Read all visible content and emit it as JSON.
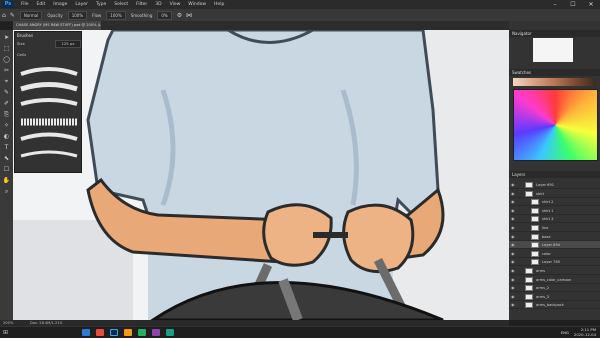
{
  "app": {
    "logo": "Ps"
  },
  "menu": [
    "File",
    "Edit",
    "Image",
    "Layer",
    "Type",
    "Select",
    "Filter",
    "3D",
    "View",
    "Window",
    "Help"
  ],
  "window_controls": {
    "minimize": "–",
    "maximize": "☐",
    "close": "✕"
  },
  "options_bar": {
    "preset": "Normal",
    "opacity_label": "Opacity",
    "opacity": "100%",
    "flow_label": "Flow",
    "flow": "100%",
    "smoothing_label": "Smoothing",
    "smoothing": "0%"
  },
  "document_tab": "CHASE ANGRY (MS RAW STUFF) psd @ 200% (Layer 793, RGB/8) *",
  "brush_panel": {
    "title": "Brushes",
    "size_label": "Size",
    "size": "125 px",
    "folder": "Cells"
  },
  "navigator": {
    "title": "Navigator"
  },
  "swatches": {
    "title": "Swatches"
  },
  "layers": {
    "title": "Layers",
    "items": [
      {
        "name": "Layer 691",
        "indent": 0
      },
      {
        "name": "shirt",
        "indent": 0
      },
      {
        "name": "shirt 2",
        "indent": 1
      },
      {
        "name": "shirt 1",
        "indent": 1
      },
      {
        "name": "shirt 3",
        "indent": 1
      },
      {
        "name": "line",
        "indent": 1
      },
      {
        "name": "base",
        "indent": 1
      },
      {
        "name": "Layer 894",
        "indent": 1,
        "selected": true
      },
      {
        "name": "color",
        "indent": 1
      },
      {
        "name": "Layer 785",
        "indent": 1
      },
      {
        "name": "arms",
        "indent": 0
      },
      {
        "name": "arms_color_cartoon",
        "indent": 0
      },
      {
        "name": "arms_2",
        "indent": 0
      },
      {
        "name": "arms_3",
        "indent": 0
      },
      {
        "name": "arms_backpack",
        "indent": 0
      }
    ]
  },
  "status": {
    "zoom": "200%",
    "doc": "Doc: 26.4M/1.21G"
  },
  "taskbar": {
    "time": "2:11 PM",
    "date": "2020-12-04",
    "lang": "ENG"
  },
  "colors": {
    "accent": "#31a8ff",
    "shirt": "#c9d7e3",
    "skin": "#e9a878",
    "bag": "#3a3a3a"
  }
}
